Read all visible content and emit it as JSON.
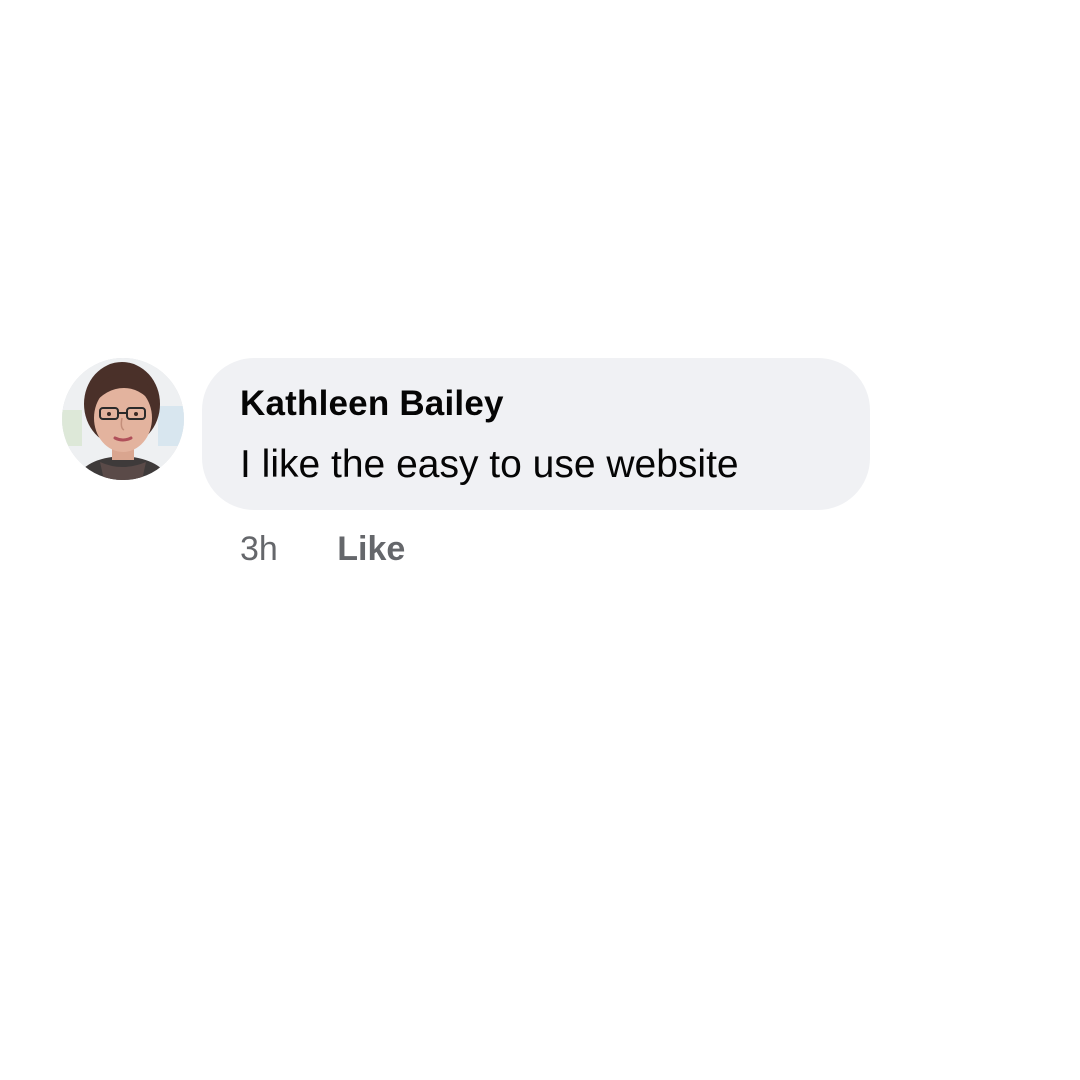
{
  "comment": {
    "author": "Kathleen Bailey",
    "text": "I like the easy to use website",
    "timestamp": "3h",
    "like_label": "Like",
    "avatar_icon": "user-avatar-photo"
  },
  "colors": {
    "bubble_bg": "#f0f1f4",
    "text_primary": "#050505",
    "text_secondary": "#65676b"
  }
}
